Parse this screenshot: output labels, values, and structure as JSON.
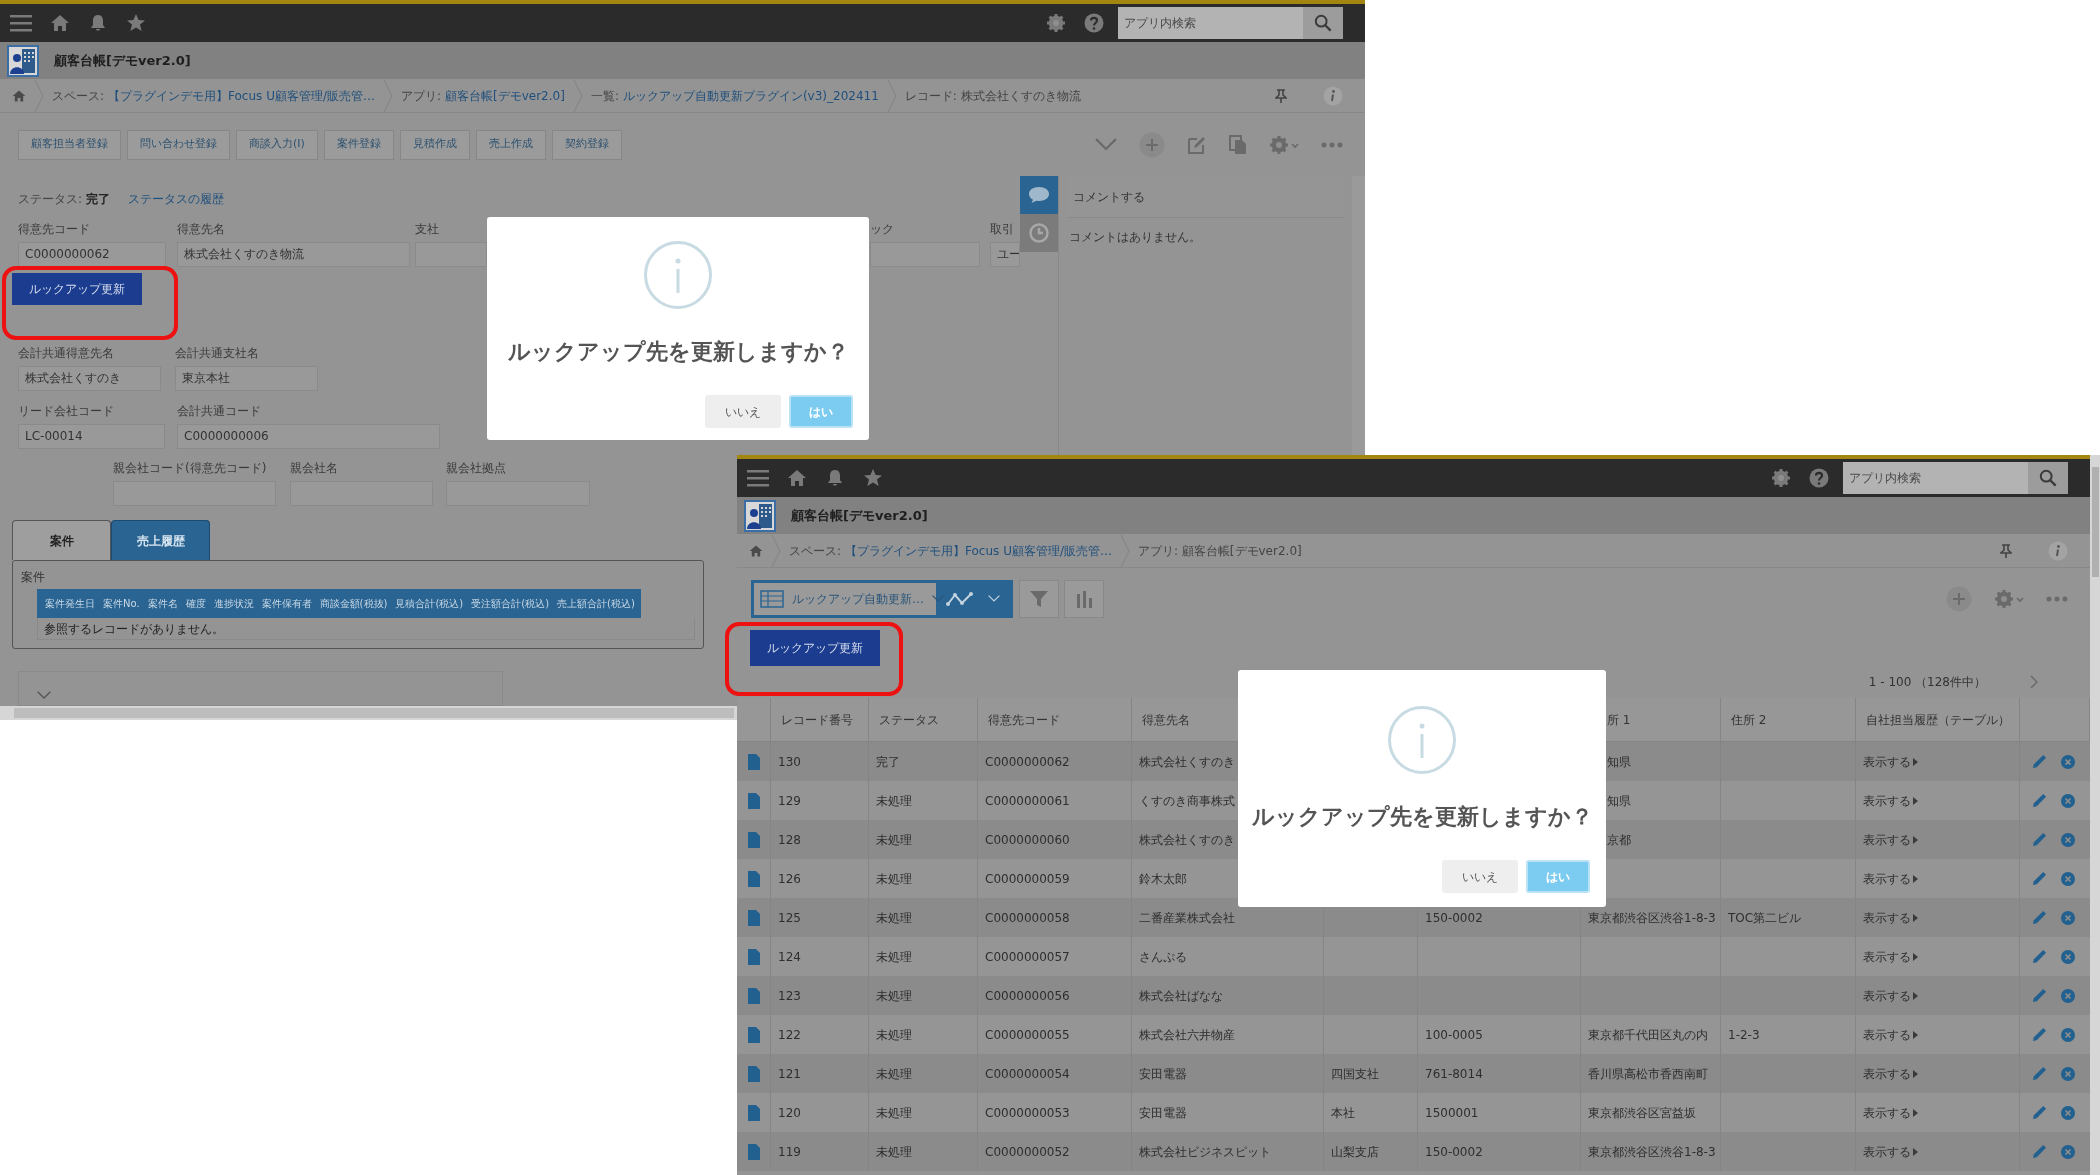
{
  "record_screen": {
    "search": {
      "placeholder": "アプリ内検索"
    },
    "app_title": "顧客台帳[デモver2.0]",
    "breadcrumb": [
      {
        "label": "スペース:",
        "link": "【プラグインデモ用】Focus U顧客管理/販売管…"
      },
      {
        "label": "アプリ:",
        "link": "顧客台帳[デモver2.0]"
      },
      {
        "label": "一覧:",
        "link": "ルックアップ自動更新プラグイン(v3)_202411"
      },
      {
        "label": "レコード: 株式会社くすのき物流"
      }
    ],
    "action_buttons": [
      "顧客担当者登録",
      "問い合わせ登録",
      "商談入力(I)",
      "案件登録",
      "見積作成",
      "売上作成",
      "契約登録"
    ],
    "status": {
      "label": "ステータス:",
      "value": "完了",
      "history_link": "ステータスの履歴"
    },
    "top_fields": [
      {
        "label": "得意先コード",
        "value": "C0000000062"
      },
      {
        "label": "得意先名",
        "value": "株式会社くすのき物流"
      },
      {
        "label": "支社"
      },
      {
        "label": "ック"
      },
      {
        "label": "取引",
        "value": "ユー"
      }
    ],
    "lookup_button": "ルックアップ更新",
    "field_rows": [
      [
        {
          "label": "会計共通得意先名",
          "value": "株式会社くすのき"
        },
        {
          "label": "会計共通支社名",
          "value": "東京本社"
        }
      ],
      [
        {
          "label": "リード会社コード",
          "value": "LC-00014"
        },
        {
          "label": "会計共通コード",
          "value": "C0000000006"
        }
      ],
      [
        {
          "label": "親会社コード(得意先コード)"
        },
        {
          "label": "親会社名"
        },
        {
          "label": "親会社拠点"
        }
      ]
    ],
    "tabs": [
      {
        "label": "案件",
        "selected": true
      },
      {
        "label": "売上履歴",
        "selected": false
      }
    ],
    "subtable": {
      "title": "案件",
      "columns": [
        "案件発生日",
        "案件No.",
        "案件名",
        "確度",
        "進捗状況",
        "案件保有者",
        "商談金額(税抜)",
        "見積合計(税込)",
        "受注額合計(税込)",
        "売上額合計(税込)"
      ],
      "empty_message": "参照するレコードがありません。"
    },
    "comments": {
      "placeholder": "コメントする",
      "empty_message": "コメントはありません。"
    },
    "dialog": {
      "message": "ルックアップ先を更新しますか？",
      "buttons": [
        {
          "label": "いいえ",
          "kind": "secondary"
        },
        {
          "label": "はい",
          "kind": "primary"
        }
      ]
    }
  },
  "list_screen": {
    "search": {
      "placeholder": "アプリ内検索"
    },
    "app_title": "顧客台帳[デモver2.0]",
    "breadcrumb": [
      {
        "label": "スペース:",
        "link": "【プラグインデモ用】Focus U顧客管理/販売管…"
      },
      {
        "label": "アプリ: 顧客台帳[デモver2.0]"
      }
    ],
    "view_selector": "ルックアップ自動更新…",
    "lookup_button": "ルックアップ更新",
    "pagination": "1 - 100 （128件中）",
    "table": {
      "columns": [
        "レコード番号",
        "ステータス",
        "得意先コード",
        "得意先名",
        null,
        null,
        "所 1",
        "住所 2",
        "自社担当履歴（テーブル）"
      ],
      "rows": [
        {
          "cells": [
            "130",
            "完了",
            "C0000000062",
            "株式会社くすのき",
            null,
            null,
            "知県",
            null
          ],
          "history_link": "表示する"
        },
        {
          "cells": [
            "129",
            "未処理",
            "C0000000061",
            "くすのき商事株式",
            null,
            null,
            "知県",
            null
          ],
          "history_link": "表示する"
        },
        {
          "cells": [
            "128",
            "未処理",
            "C0000000060",
            "株式会社くすのき",
            null,
            null,
            "京都",
            null
          ],
          "history_link": "表示する"
        },
        {
          "cells": [
            "126",
            "未処理",
            "C0000000059",
            "鈴木太郎",
            null,
            null,
            null,
            null
          ],
          "history_link": "表示する"
        },
        {
          "cells": [
            "125",
            "未処理",
            "C0000000058",
            "二番産業株式会社",
            null,
            "150-0002",
            "東京都渋谷区渋谷1-8-3",
            "TOC第二ビル"
          ],
          "history_link": "表示する"
        },
        {
          "cells": [
            "124",
            "未処理",
            "C0000000057",
            "さんぷる",
            null,
            null,
            null,
            null
          ],
          "history_link": "表示する"
        },
        {
          "cells": [
            "123",
            "未処理",
            "C0000000056",
            "株式会社ばなな",
            null,
            null,
            null,
            null
          ],
          "history_link": "表示する"
        },
        {
          "cells": [
            "122",
            "未処理",
            "C0000000055",
            "株式会社六井物産",
            null,
            "100-0005",
            "東京都千代田区丸の内",
            "1-2-3"
          ],
          "history_link": "表示する"
        },
        {
          "cells": [
            "121",
            "未処理",
            "C0000000054",
            "安田電器",
            "四国支社",
            "761-8014",
            "香川県高松市香西南町",
            null
          ],
          "history_link": "表示する"
        },
        {
          "cells": [
            "120",
            "未処理",
            "C0000000053",
            "安田電器",
            "本社",
            "1500001",
            "東京都渋谷区宮益坂",
            null
          ],
          "history_link": "表示する"
        },
        {
          "cells": [
            "119",
            "未処理",
            "C0000000052",
            "株式会社ビジネスピット",
            "山梨支店",
            "150-0002",
            "東京都渋谷区渋谷1-8-3",
            null
          ],
          "history_link": "表示する"
        }
      ]
    },
    "dialog": {
      "message": "ルックアップ先を更新しますか？",
      "buttons": [
        {
          "label": "いいえ",
          "kind": "secondary"
        },
        {
          "label": "はい",
          "kind": "primary"
        }
      ]
    }
  }
}
